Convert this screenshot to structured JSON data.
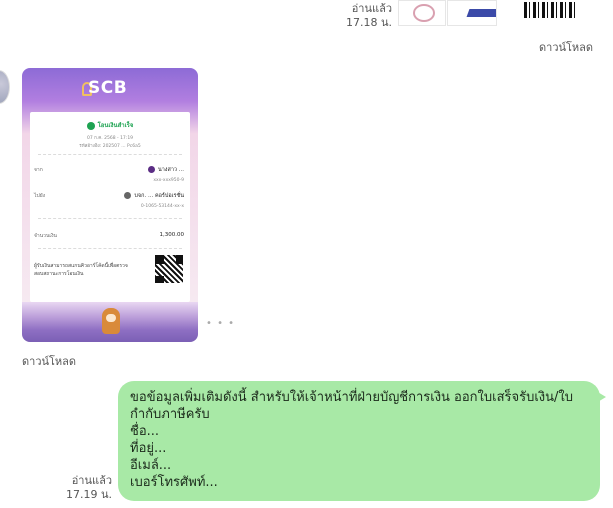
{
  "top_message": {
    "read_label": "อ่านแล้ว",
    "time": "17.18 น.",
    "download_label": "ดาวน์โหลด"
  },
  "slip": {
    "brand": "SCB",
    "status": "โอนเงินสำเร็จ",
    "date": "07 ก.ค. 2568 - 17:19",
    "ref": "รหัสอ้างอิง: 202507 ... Pc6a5",
    "from_label": "จาก",
    "from_name": "นางสาว ...",
    "from_account": "xxx-xxx950-9",
    "to_label": "ไปยัง",
    "to_name": "บจก. ... คอร์ปอเรชั่น",
    "to_account": "0-1065-53144-xx-x",
    "amount_label": "จำนวนเงิน",
    "amount": "1,300.00",
    "verify_text": "ผู้รับเงินสามารถสแกนคิวอาร์โค้ดนี้เพื่อตรวจสอบสถานะการโอนเงิน"
  },
  "slip_message": {
    "download_label": "ดาวน์โหลด",
    "more": "• • •"
  },
  "reply": {
    "read_label": "อ่านแล้ว",
    "time": "17.19 น.",
    "lines": [
      "ขอข้อมูลเพิ่มเติมดังนี้ สำหรับให้เจ้าหน้าที่ฝ่ายบัญชีการเงิน ออกใบเสร็จรับเงิน/ใบ",
      "กำกับภาษีครับ",
      "ชื่อ...",
      "ที่อยู่...",
      "อีเมล์...",
      "เบอร์โทรศัพท์..."
    ]
  }
}
